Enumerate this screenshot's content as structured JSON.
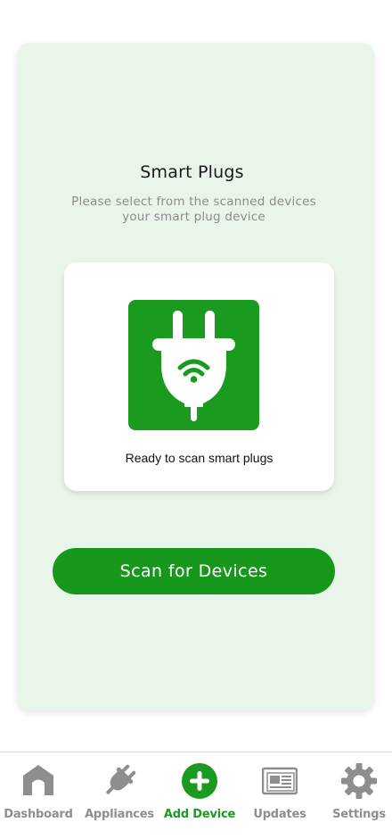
{
  "page": {
    "title": "Smart Plugs",
    "subtitle_line1": "Please select  from the scanned devices",
    "subtitle_line2": "your smart plug device"
  },
  "scan_panel": {
    "icon": "smart-plug-wifi-icon",
    "status": "Ready to scan smart plugs"
  },
  "primary_action": {
    "label": "Scan for Devices"
  },
  "nav": {
    "items": [
      {
        "label": "Dashboard",
        "icon": "house-icon",
        "active": false
      },
      {
        "label": "Appliances",
        "icon": "plug-icon",
        "active": false
      },
      {
        "label": "Add Device",
        "icon": "plus-circle-icon",
        "active": true
      },
      {
        "label": "Updates",
        "icon": "newspaper-icon",
        "active": false
      },
      {
        "label": "Settings",
        "icon": "gear-icon",
        "active": false
      }
    ]
  },
  "colors": {
    "accent": "#1a9a1f",
    "card_bg": "#e8f5e8",
    "inactive": "#8e8e8e"
  }
}
